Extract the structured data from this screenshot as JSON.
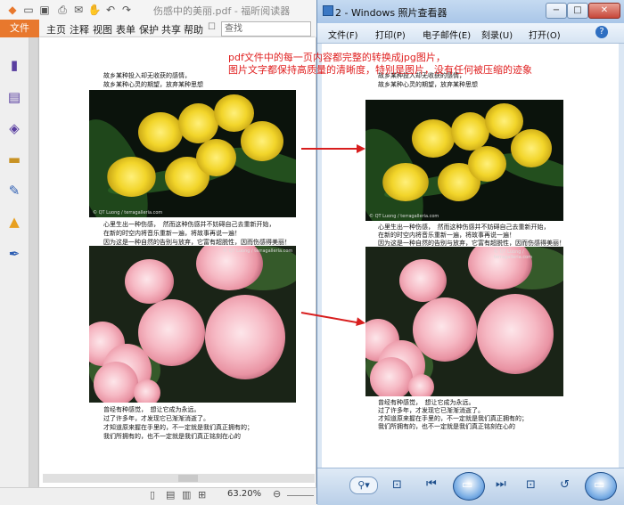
{
  "foxit": {
    "title": "伤感中的美丽.pdf - 福昕阅读器",
    "file_tab": "文件",
    "menus": [
      "主页",
      "注释",
      "视图",
      "表单",
      "保护",
      "共享",
      "帮助"
    ],
    "search_placeholder": "查找",
    "zoom": "63.20%",
    "text_top": [
      "故乡某种投入却无收获的感情，",
      "故乡某种心灵的期望，放弃某种思想"
    ],
    "copyright1": "© QT Luong / terragalleria.com",
    "text_mid": [
      "心里生出一种伤感，　然而这种伤感并不妨碍自己去重新开始，",
      "在新的时空内将音乐重新一遍，将故事再说一遍！",
      "因为这是一种自然的告别与放弃，它富有超脱性，因而伤感得美丽！"
    ],
    "copyright2": "© QT Luong / terragalleria.com",
    "text_bottom": [
      "曾经有种感觉，　想让它成为永远。",
      "过了许多年，才发现它已渐渐消逝了。",
      "才知道原来握在手里的，不一定就是我们真正拥有的；",
      "我们所拥有的，也不一定就是我们真正铭刻在心的"
    ]
  },
  "viewer": {
    "title": "2 - Windows 照片查看器",
    "min": "−",
    "max": "□",
    "close": "✕",
    "menus": [
      "文件(F)",
      "打印(P)",
      "电子邮件(E)",
      "刻录(U)",
      "打开(O)"
    ]
  },
  "annotation": [
    "pdf文件中的每一页内容都完整的转换成jpg图片，",
    "图片文字都保持高质量的清晰度，特别是图片，没有任何被压缩的迹象"
  ],
  "colors": {
    "accent": "#e8782d",
    "annotation": "#e02020",
    "viewer_bg": "#dbe7f4"
  }
}
